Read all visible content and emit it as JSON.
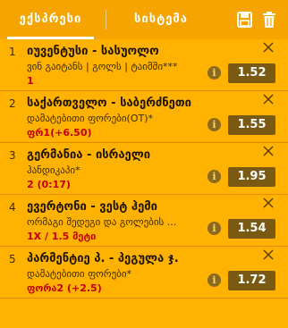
{
  "tabs": {
    "express": "ექსპრესი",
    "system": "სისტემა"
  },
  "header_icons": {
    "save": "save-icon",
    "trash": "trash-icon"
  },
  "bets": [
    {
      "num": "1",
      "teams": "იუვენტუსი - სასუოლო",
      "market": "ვინ გაიტანს | გოლს | ტაიმში***",
      "selection": "1",
      "odds": "1.52"
    },
    {
      "num": "2",
      "teams": "საქართველო - საბერძნეთი",
      "market": "დამატებითი ფორები(OT)*",
      "selection": "ფრ1(+6.50)",
      "odds": "1.55"
    },
    {
      "num": "3",
      "teams": "გერმანია - ისრაელი",
      "market": "ჰანდიკაპი*",
      "selection": "2 (0:17)",
      "odds": "1.95"
    },
    {
      "num": "4",
      "teams": "ევერტონი - ვესტ ჰემი",
      "market": "ორმაგი შედეგი და გოლების ...",
      "selection": "1X / 1.5 მეტი",
      "odds": "1.54"
    },
    {
      "num": "5",
      "teams": "პარმენტიე პ. - პეგულა ჯ.",
      "market": "დამატებითი ფორები*",
      "selection": "ფორა2 (+2.5)",
      "odds": "1.72"
    }
  ],
  "colors": {
    "background": "#ffb300",
    "header": "#f5a400",
    "odds_bg": "#7a5a12",
    "selection": "#c40000"
  }
}
